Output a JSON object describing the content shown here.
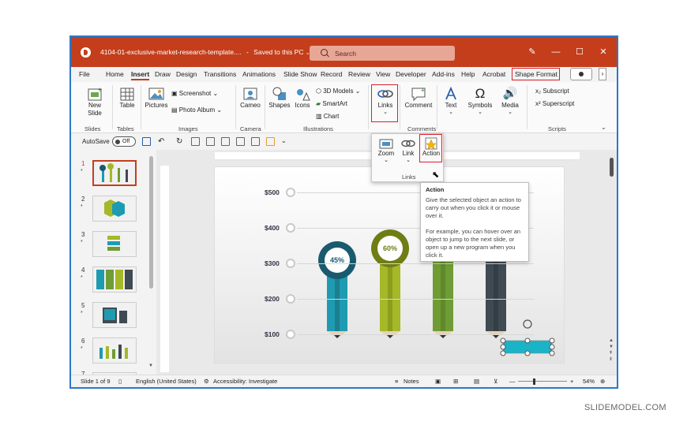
{
  "titlebar": {
    "doc_title": "4104-01-exclusive-market-research-template....",
    "save_status": "Saved to this PC",
    "search_placeholder": "Search"
  },
  "tabs": [
    "File",
    "Home",
    "Insert",
    "Draw",
    "Design",
    "Transitions",
    "Animations",
    "Slide Show",
    "Record",
    "Review",
    "View",
    "Developer",
    "Add-ins",
    "Help",
    "Acrobat",
    "Shape Format"
  ],
  "ribbon": {
    "new_slide": "New\nSlide",
    "table": "Table",
    "pictures": "Pictures",
    "screenshot": "Screenshot",
    "photo_album": "Photo Album",
    "cameo": "Cameo",
    "shapes": "Shapes",
    "icons": "Icons",
    "models_3d": "3D Models",
    "smartart": "SmartArt",
    "chart": "Chart",
    "links": "Links",
    "comment": "Comment",
    "text": "Text",
    "symbols": "Symbols",
    "media": "Media",
    "subscript": "Subscript",
    "superscript": "Superscript",
    "groups": {
      "slides": "Slides",
      "tables": "Tables",
      "images": "Images",
      "camera": "Camera",
      "illustrations": "Illustrations",
      "comments": "Comments",
      "scripts": "Scripts"
    }
  },
  "qat": {
    "autosave": "AutoSave",
    "toggle": "Off"
  },
  "thumbnails": [
    {
      "num": "1",
      "star": "*"
    },
    {
      "num": "2",
      "star": "*"
    },
    {
      "num": "3",
      "star": "*"
    },
    {
      "num": "4",
      "star": "*"
    },
    {
      "num": "5",
      "star": "*"
    },
    {
      "num": "6",
      "star": "*"
    },
    {
      "num": "7",
      "star": ""
    }
  ],
  "slide": {
    "y_labels": [
      "$500",
      "$400",
      "$300",
      "$200",
      "$100"
    ],
    "pencils": [
      {
        "label": "45%",
        "color": "#1e9bb0",
        "cap": "#1a5a6e"
      },
      {
        "label": "60%",
        "color": "#a5b827",
        "cap": "#6f7d14"
      },
      {
        "label": "",
        "color": "#6f9c34",
        "cap": "#4e7324"
      },
      {
        "label": "",
        "color": "#3f4a52",
        "cap": "#283036"
      }
    ]
  },
  "dropdown": {
    "zoom": "Zoom",
    "link": "Link",
    "action": "Action",
    "group": "Links"
  },
  "tooltip": {
    "title": "Action",
    "p1": "Give the selected object an action to carry out when you click it or mouse over it.",
    "p2": "For example, you can hover over an object to jump to the next slide, or open up a new program when you click it."
  },
  "status": {
    "slide_of": "Slide 1 of 9",
    "language": "English (United States)",
    "accessibility": "Accessibility: Investigate",
    "notes": "Notes",
    "zoom": "54%"
  },
  "watermark": "SLIDEMODEL.COM",
  "colors": {
    "accent": "#c43e1c",
    "highlight": "#d9202c",
    "border": "#2b78c8"
  }
}
